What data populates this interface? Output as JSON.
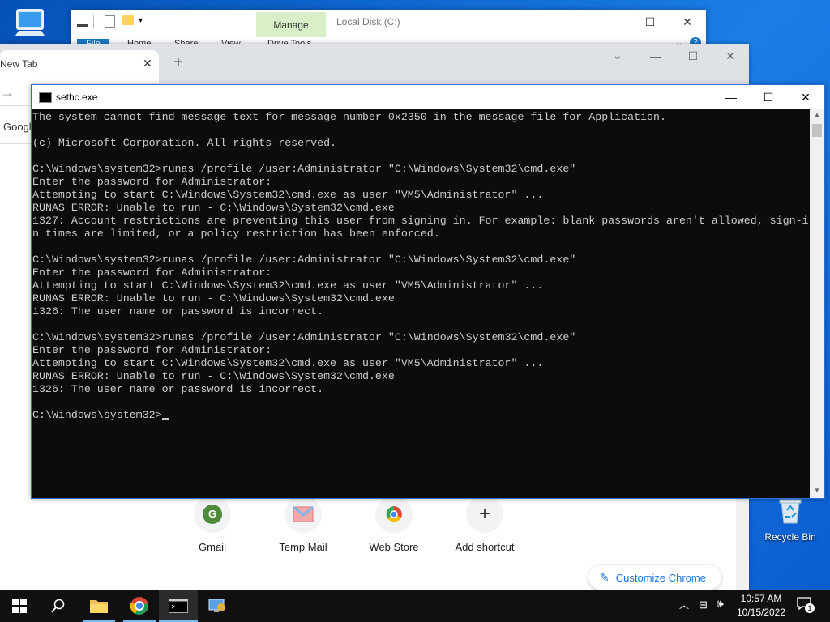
{
  "explorer": {
    "manage_tab": "Manage",
    "title": "Local Disk (C:)",
    "ribbon_tabs": [
      "File",
      "Home",
      "Share",
      "View",
      "Drive Tools"
    ]
  },
  "chrome": {
    "tab_title": "New Tab",
    "google_label": "Googl",
    "shortcuts": [
      {
        "label": "Gmail",
        "glyph": "G"
      },
      {
        "label": "Temp Mail",
        "glyph": ""
      },
      {
        "label": "Web Store",
        "glyph": ""
      },
      {
        "label": "Add shortcut",
        "glyph": "+"
      }
    ],
    "customize_label": "Customize Chrome"
  },
  "cmd": {
    "title": "sethc.exe",
    "lines": [
      "The system cannot find message text for message number 0x2350 in the message file for Application.",
      "",
      "(c) Microsoft Corporation. All rights reserved.",
      "",
      "C:\\Windows\\system32>runas /profile /user:Administrator \"C:\\Windows\\System32\\cmd.exe\"",
      "Enter the password for Administrator:",
      "Attempting to start C:\\Windows\\System32\\cmd.exe as user \"VM5\\Administrator\" ...",
      "RUNAS ERROR: Unable to run - C:\\Windows\\System32\\cmd.exe",
      "1327: Account restrictions are preventing this user from signing in. For example: blank passwords aren't allowed, sign-i",
      "n times are limited, or a policy restriction has been enforced.",
      "",
      "C:\\Windows\\system32>runas /profile /user:Administrator \"C:\\Windows\\System32\\cmd.exe\"",
      "Enter the password for Administrator:",
      "Attempting to start C:\\Windows\\System32\\cmd.exe as user \"VM5\\Administrator\" ...",
      "RUNAS ERROR: Unable to run - C:\\Windows\\System32\\cmd.exe",
      "1326: The user name or password is incorrect.",
      "",
      "C:\\Windows\\system32>runas /profile /user:Administrator \"C:\\Windows\\System32\\cmd.exe\"",
      "Enter the password for Administrator:",
      "Attempting to start C:\\Windows\\System32\\cmd.exe as user \"VM5\\Administrator\" ...",
      "RUNAS ERROR: Unable to run - C:\\Windows\\System32\\cmd.exe",
      "1326: The user name or password is incorrect.",
      ""
    ],
    "prompt": "C:\\Windows\\system32>"
  },
  "desktop": {
    "recycle_bin": "Recycle Bin"
  },
  "taskbar": {
    "time": "10:57 AM",
    "date": "10/15/2022",
    "notification_count": "1"
  },
  "colors": {
    "cmd_bg": "#0c0c0c",
    "cmd_text": "#cccccc",
    "manage_tab_bg": "#d8efc7",
    "taskbar_bg": "#101010",
    "desktop_bg": "#0a64d6"
  }
}
